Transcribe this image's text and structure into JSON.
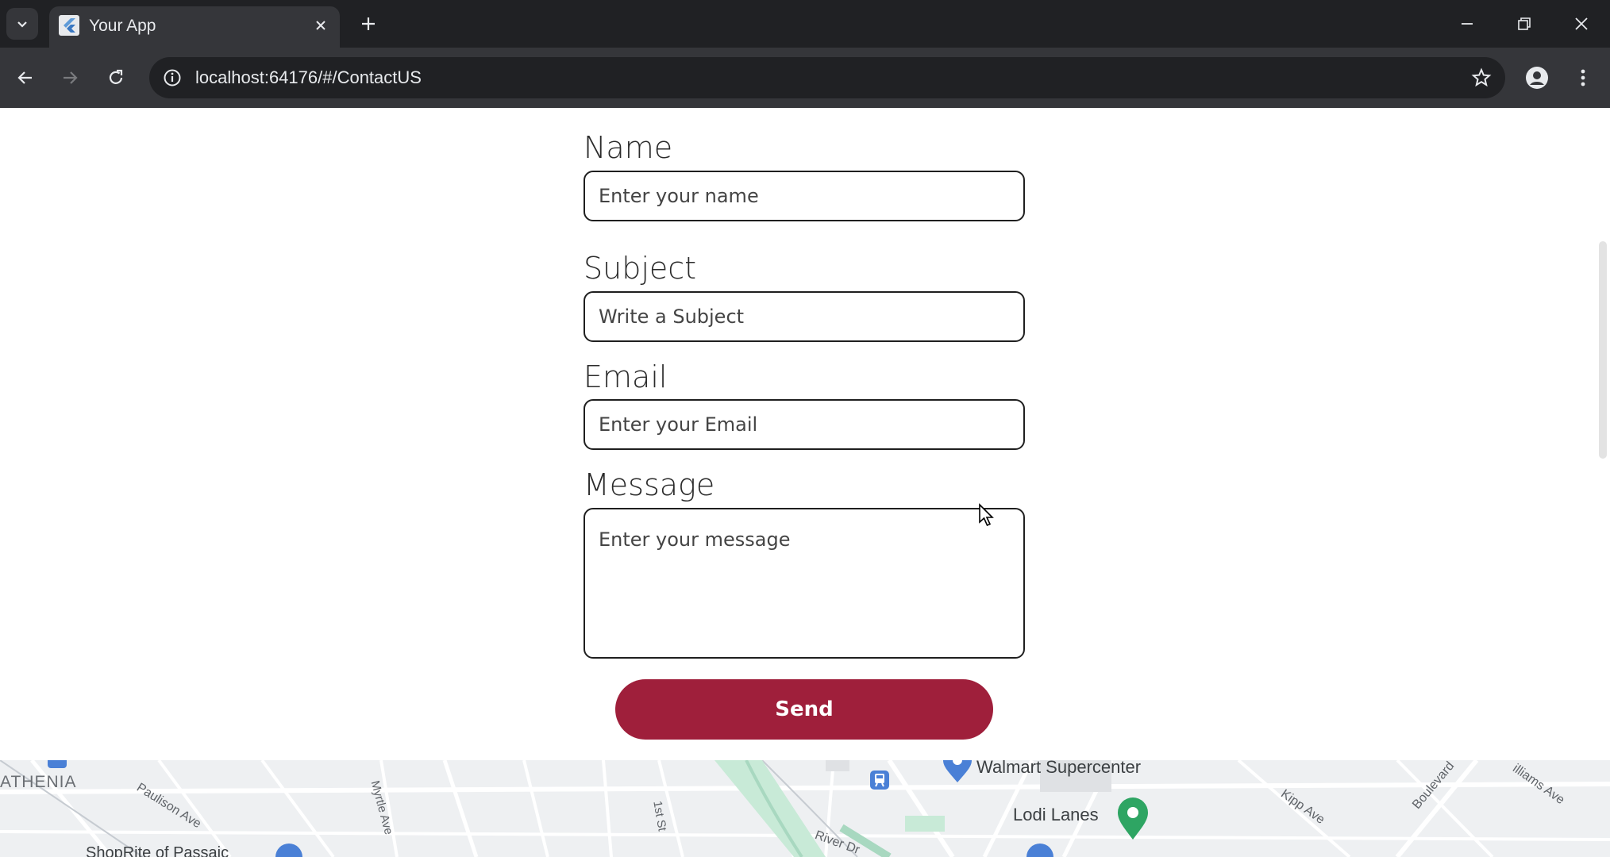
{
  "browser": {
    "tab_title": "Your App",
    "url": "localhost:64176/#/ContactUS"
  },
  "form": {
    "name_label": "Name",
    "name_placeholder": "Enter your name",
    "subject_label": "Subject",
    "subject_placeholder": "Write a Subject",
    "email_label": "Email",
    "email_placeholder": "Enter your Email",
    "message_label": "Message",
    "message_placeholder": "Enter your message",
    "send_label": "Send"
  },
  "map": {
    "labels": {
      "athenia": "ATHENIA",
      "paulison": "Paulison Ave",
      "myrtle": "Myrtle Ave",
      "first_st": "1st St",
      "river_dr": "River Dr",
      "walmart": "Walmart Supercenter",
      "lodi_lanes": "Lodi Lanes",
      "kipp": "Kipp Ave",
      "boulevard": "Boulevard",
      "williams": "illiams Ave",
      "shoprite": "ShopRite of Passaic"
    }
  },
  "colors": {
    "send_button": "#9f1f3b",
    "tabbar": "#202124",
    "toolbar": "#35363a"
  }
}
